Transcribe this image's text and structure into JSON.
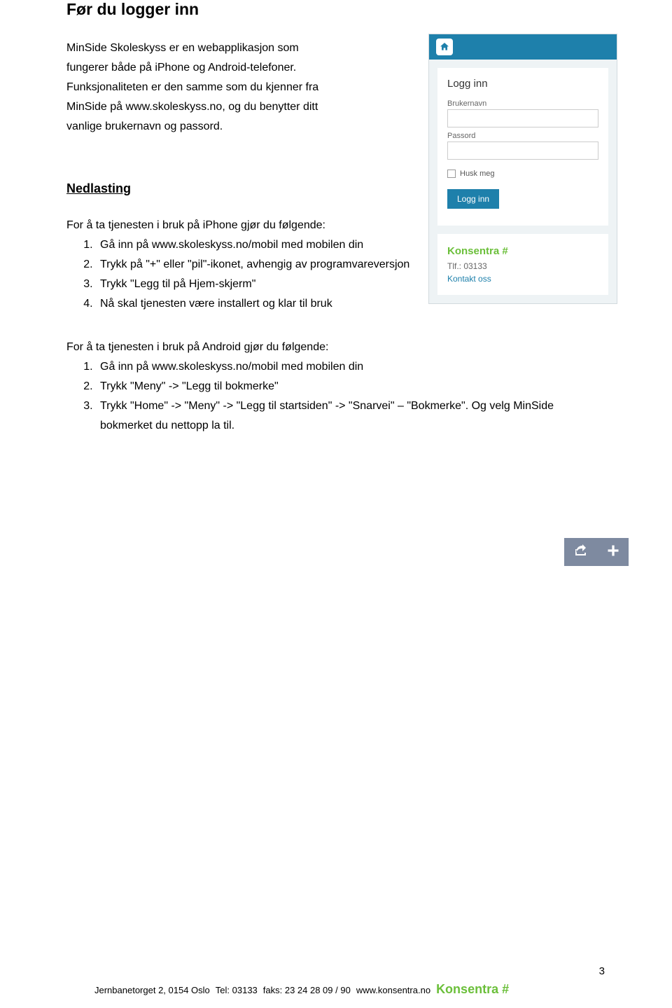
{
  "heading": "Før du logger inn",
  "intro": [
    "MinSide Skoleskyss er en webapplikasjon som",
    "fungerer både på iPhone og Android-telefoner.",
    "Funksjonaliteten er den samme som du kjenner fra",
    "MinSide på www.skoleskyss.no, og du benytter ditt",
    "vanlige brukernavn og passord."
  ],
  "section_heading": "Nedlasting",
  "iphone_intro": "For å ta tjenesten i bruk på iPhone gjør du følgende:",
  "iphone_steps": [
    "Gå inn på www.skoleskyss.no/mobil med mobilen din",
    "Trykk på \"+\" eller \"pil\"-ikonet, avhengig av programvareversjon",
    "Trykk \"Legg til på Hjem-skjerm\"",
    "Nå skal tjenesten være installert og klar til bruk"
  ],
  "android_intro": "For å ta tjenesten i bruk på Android gjør du følgende:",
  "android_steps": [
    "Gå inn på www.skoleskyss.no/mobil med mobilen din",
    "Trykk \"Meny\" -> \"Legg til bokmerke\"",
    "Trykk \"Home\" -> \"Meny\" -> \"Legg til startsiden\" -> \"Snarvei\" – \"Bokmerke\". Og velg MinSide bokmerket du nettopp la til."
  ],
  "login": {
    "title": "Logg inn",
    "user_label": "Brukernavn",
    "pass_label": "Passord",
    "remember": "Husk meg",
    "button": "Logg inn"
  },
  "contact": {
    "brand": "Konsentra #",
    "tlf": "Tlf.: 03133",
    "link": "Kontakt oss"
  },
  "footer": {
    "address": "Jernbanetorget 2, 0154 Oslo",
    "tel": "Tel: 03133",
    "fax": "faks: 23 24 28 09 / 90",
    "web": "www.konsentra.no",
    "brand": "Konsentra #"
  },
  "page_number": "3"
}
